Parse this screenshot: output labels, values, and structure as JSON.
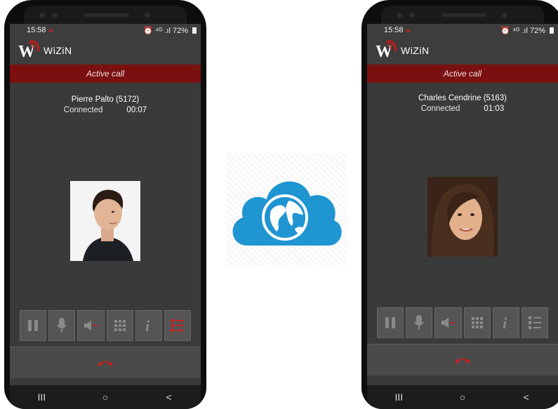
{
  "phones": [
    {
      "status_time": "15:58",
      "status_app_badge": "w",
      "status_right": "⏰ ⁴ᴳ .ıl 72%",
      "app_name": "WiZiN",
      "banner": "Active call",
      "caller": "Pierre Palto (5172)",
      "call_status": "Connected",
      "duration": "00:07",
      "list_active": true
    },
    {
      "status_time": "15:58",
      "status_app_badge": "w",
      "status_right": "⏰ ⁴ᴳ .ıl 72%",
      "app_name": "WiZiN",
      "banner": "Active call",
      "caller": "Charles Cendrine (5163)",
      "call_status": "Connected",
      "duration": "01:03",
      "list_active": false
    }
  ],
  "controls": [
    "pause-icon",
    "mic-icon",
    "speaker-icon",
    "dialpad-icon",
    "info-icon",
    "list-icon"
  ],
  "nav": {
    "recents": "III",
    "home": "○",
    "back": "<"
  },
  "colors": {
    "accent_red": "#c41a1a",
    "banner": "#7a1010",
    "cloud": "#1f95d2"
  }
}
